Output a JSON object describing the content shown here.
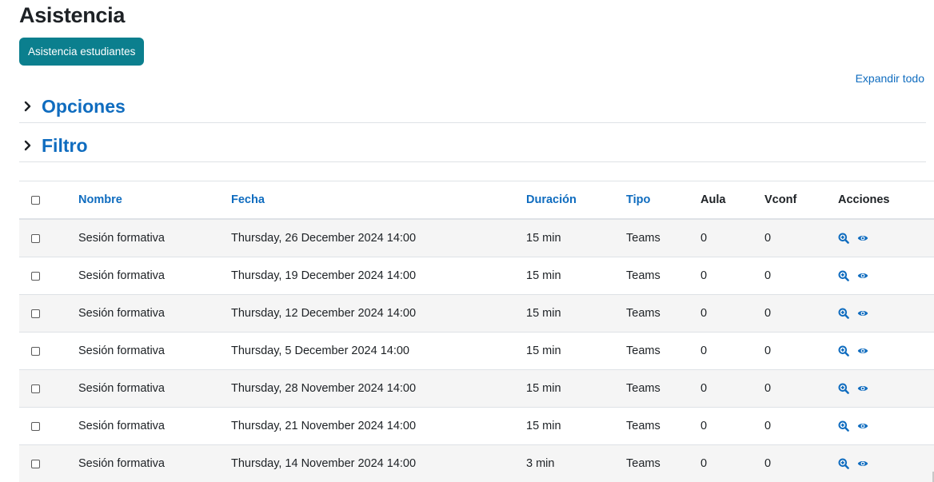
{
  "page": {
    "title": "Asistencia",
    "primary_button": "Asistencia estudiantes",
    "expand_all": "Expandir todo"
  },
  "sections": {
    "opciones": "Opciones",
    "filtro": "Filtro"
  },
  "colors": {
    "primary_button": "#0b7f8e",
    "link": "#0f6cbf",
    "row_stripe": "#f5f5f5"
  },
  "table": {
    "headers": {
      "nombre": "Nombre",
      "fecha": "Fecha",
      "duracion": "Duración",
      "tipo": "Tipo",
      "aula": "Aula",
      "vconf": "Vconf",
      "acciones": "Acciones"
    },
    "rows": [
      {
        "nombre": "Sesión formativa",
        "fecha": "Thursday, 26 December 2024 14:00",
        "duracion": "15 min",
        "tipo": "Teams",
        "aula": "0",
        "vconf": "0"
      },
      {
        "nombre": "Sesión formativa",
        "fecha": "Thursday, 19 December 2024 14:00",
        "duracion": "15 min",
        "tipo": "Teams",
        "aula": "0",
        "vconf": "0"
      },
      {
        "nombre": "Sesión formativa",
        "fecha": "Thursday, 12 December 2024 14:00",
        "duracion": "15 min",
        "tipo": "Teams",
        "aula": "0",
        "vconf": "0"
      },
      {
        "nombre": "Sesión formativa",
        "fecha": "Thursday, 5 December 2024 14:00",
        "duracion": "15 min",
        "tipo": "Teams",
        "aula": "0",
        "vconf": "0"
      },
      {
        "nombre": "Sesión formativa",
        "fecha": "Thursday, 28 November 2024 14:00",
        "duracion": "15 min",
        "tipo": "Teams",
        "aula": "0",
        "vconf": "0"
      },
      {
        "nombre": "Sesión formativa",
        "fecha": "Thursday, 21 November 2024 14:00",
        "duracion": "15 min",
        "tipo": "Teams",
        "aula": "0",
        "vconf": "0"
      },
      {
        "nombre": "Sesión formativa",
        "fecha": "Thursday, 14 November 2024 14:00",
        "duracion": "3 min",
        "tipo": "Teams",
        "aula": "0",
        "vconf": "0"
      }
    ],
    "action_icons": [
      "zoom-in-icon",
      "eye-icon"
    ]
  }
}
